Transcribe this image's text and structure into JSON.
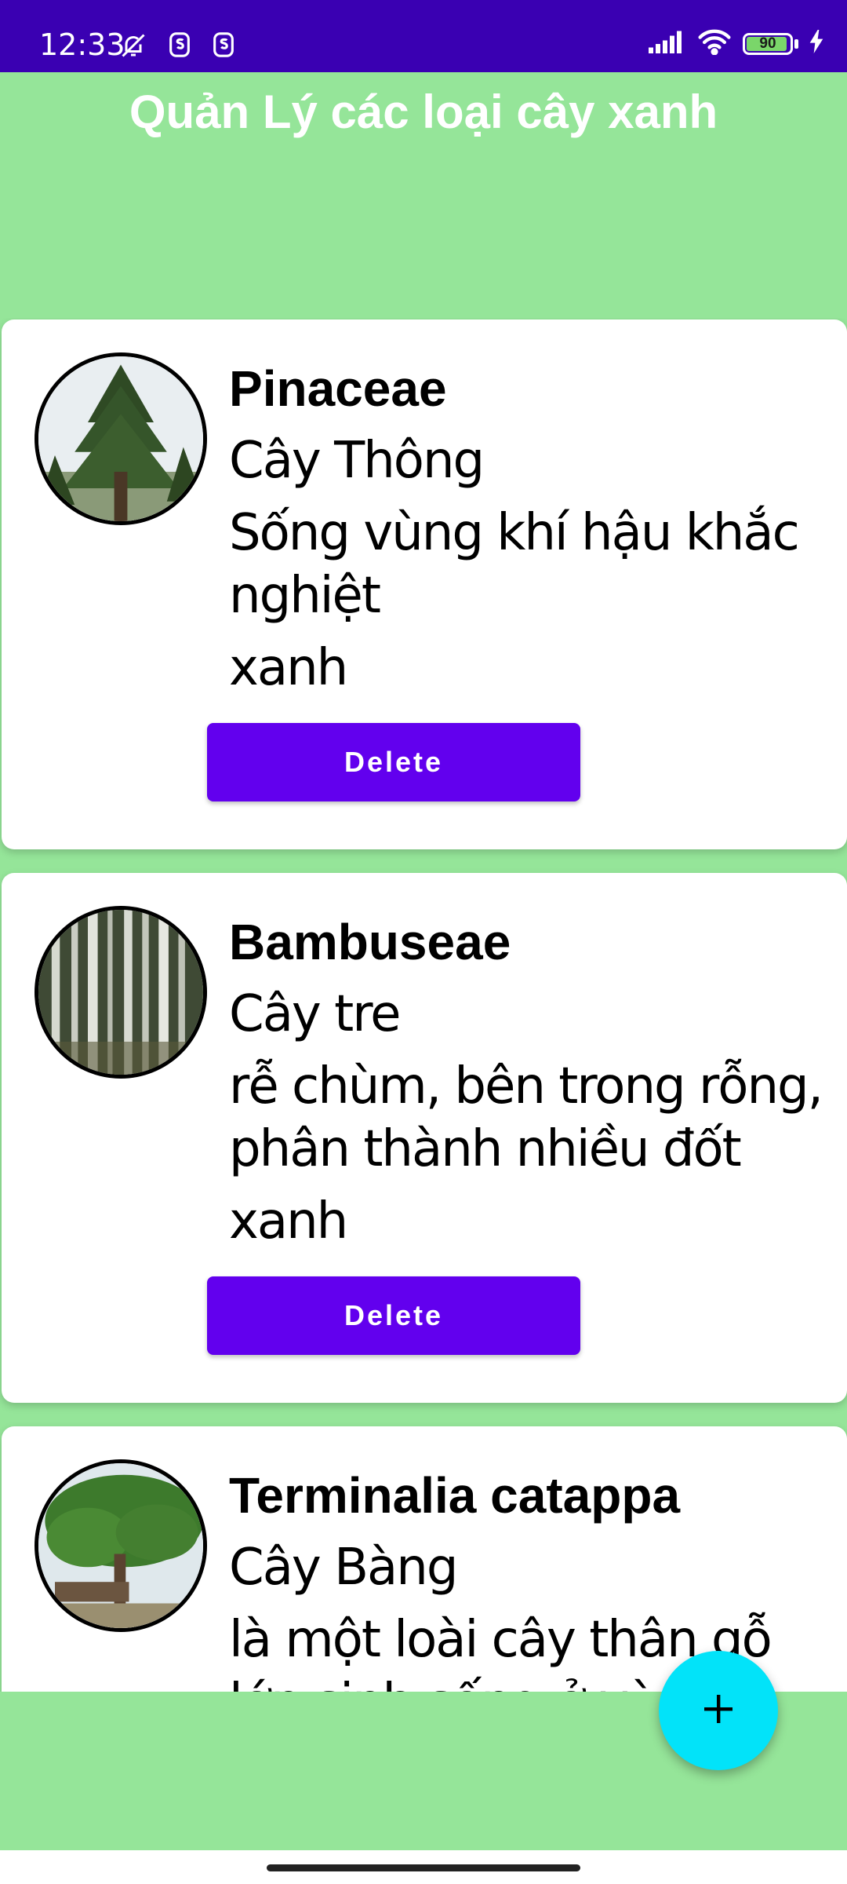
{
  "status_bar": {
    "time": "12:33",
    "battery_level": "90",
    "icons": [
      "bell-off-icon",
      "s-icon",
      "s-icon",
      "signal-icon",
      "wifi-icon",
      "battery-icon",
      "charging-icon"
    ]
  },
  "header": {
    "title": "Quản Lý các loại cây xanh"
  },
  "plants": [
    {
      "scientific_name": "Pinaceae",
      "common_name": "Cây Thông",
      "description": "Sống vùng khí hậu khắc nghiệt",
      "color": "xanh",
      "delete_label": "Delete"
    },
    {
      "scientific_name": "Bambuseae",
      "common_name": "Cây tre",
      "description": "rễ chùm, bên trong rỗng, phân thành nhiều đốt",
      "color": "xanh",
      "delete_label": "Delete"
    },
    {
      "scientific_name": "Terminalia catappa",
      "common_name": "Cây Bàng",
      "description": "là một loài cây thân gỗ lớn sinh sống ở vùng nhiệt đới",
      "color": "",
      "delete_label": ""
    }
  ],
  "fab": {
    "icon": "plus-icon"
  },
  "colors": {
    "status_bar": "#3a00b2",
    "background": "#95e599",
    "button": "#6200ee",
    "fab": "#02e3f9"
  }
}
